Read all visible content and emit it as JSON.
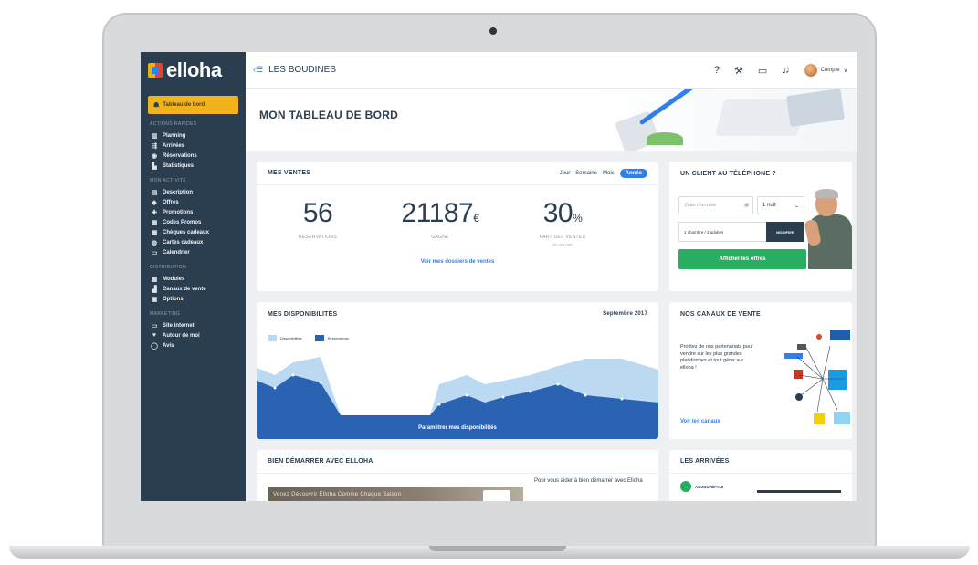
{
  "app": {
    "logo_text": "elloha"
  },
  "sidebar": {
    "dashboard_label": "Tableau de bord",
    "sections": [
      {
        "title": "ACTIONS RAPIDES",
        "items": [
          {
            "label": "Planning",
            "icon": "chart-icon",
            "glyph": "▥"
          },
          {
            "label": "Arrivées",
            "icon": "arrivals-icon",
            "glyph": "⇶"
          },
          {
            "label": "Réservations",
            "icon": "reservations-icon",
            "glyph": "◉"
          },
          {
            "label": "Statistiques",
            "icon": "statistics-icon",
            "glyph": "▙"
          }
        ]
      },
      {
        "title": "MON ACTIVITÉ",
        "items": [
          {
            "label": "Description",
            "icon": "description-icon",
            "glyph": "▤"
          },
          {
            "label": "Offres",
            "icon": "offers-icon",
            "glyph": "◆"
          },
          {
            "label": "Promotions",
            "icon": "promotions-icon",
            "glyph": "✚"
          },
          {
            "label": "Codes Promos",
            "icon": "promo-codes-icon",
            "glyph": "▦"
          },
          {
            "label": "Chèques cadeaux",
            "icon": "gift-vouchers-icon",
            "glyph": "▩"
          },
          {
            "label": "Cartes cadeaux",
            "icon": "gift-cards-icon",
            "glyph": "◍"
          },
          {
            "label": "Calendrier",
            "icon": "calendar-icon",
            "glyph": "▭"
          }
        ]
      },
      {
        "title": "DISTRIBUTION",
        "items": [
          {
            "label": "Modules",
            "icon": "modules-icon",
            "glyph": "▦"
          },
          {
            "label": "Canaux de vente",
            "icon": "channels-icon",
            "glyph": "▟"
          },
          {
            "label": "Options",
            "icon": "options-icon",
            "glyph": "▣"
          }
        ]
      },
      {
        "title": "MARKETING",
        "items": [
          {
            "label": "Site internet",
            "icon": "website-icon",
            "glyph": "▭"
          },
          {
            "label": "Autour de moi",
            "icon": "location-pin-icon",
            "glyph": "♥"
          },
          {
            "label": "Avis",
            "icon": "reviews-icon",
            "glyph": "◯"
          }
        ]
      }
    ]
  },
  "topbar": {
    "hotel_name": "LES BOUDINES",
    "account_label": "Compte",
    "icons": [
      "help-icon",
      "tools-icon",
      "monitor-icon",
      "bell-icon"
    ]
  },
  "page": {
    "title": "MON TABLEAU DE BORD"
  },
  "sales": {
    "title": "MES VENTES",
    "periods": [
      "Jour",
      "Semaine",
      "Mois",
      "Année"
    ],
    "active_period": "Année",
    "stats": [
      {
        "value": "56",
        "unit": "",
        "label": "RÉSERVATIONS",
        "sub": ""
      },
      {
        "value": "21187",
        "unit": "€",
        "label": "GAGNÉ",
        "sub": ""
      },
      {
        "value": "30",
        "unit": "%",
        "label": "PART DES VENTES",
        "sub": "sur mon site"
      }
    ],
    "link": "Voir mes dossiers de ventes"
  },
  "phone": {
    "title": "UN CLIENT AU TÉLÉPHONE ?",
    "date_placeholder": "Date d'arrivée",
    "nights": "1 nuit",
    "rooms": "1 chambre / 2 adultes",
    "modify_button": "MODIFIER",
    "offers_button": "Afficher les offres"
  },
  "availability": {
    "title": "MES DISPONIBILITÉS",
    "month": "Septembre 2017",
    "legend": [
      {
        "name": "Disponibilités",
        "color": "#bcd9f2"
      },
      {
        "name": "Réservations",
        "color": "#2b63b3"
      }
    ],
    "footer_link": "Paramétrer mes disponibilités"
  },
  "channels": {
    "title": "NOS CANAUX DE VENTE",
    "text": "Profitez de nos partenariats pour vendre sur les plus grandes plateformes et tout gérer sur elloha !",
    "link": "Voir les canaux"
  },
  "start": {
    "title": "BIEN DÉMARRER AVEC ELLOHA",
    "intro": "Pour vous aider à bien démarrer avec Elloha",
    "video_caption": "Venez Découvrir Elloha Comme Chaque Saison"
  },
  "arrivals": {
    "title": "LES ARRIVÉES",
    "first_label": "AUJOURD'HUI"
  },
  "colors": {
    "sidebar": "#2b3e50",
    "accent": "#f2b21b",
    "blue": "#2f80ed",
    "green": "#27ae60"
  }
}
